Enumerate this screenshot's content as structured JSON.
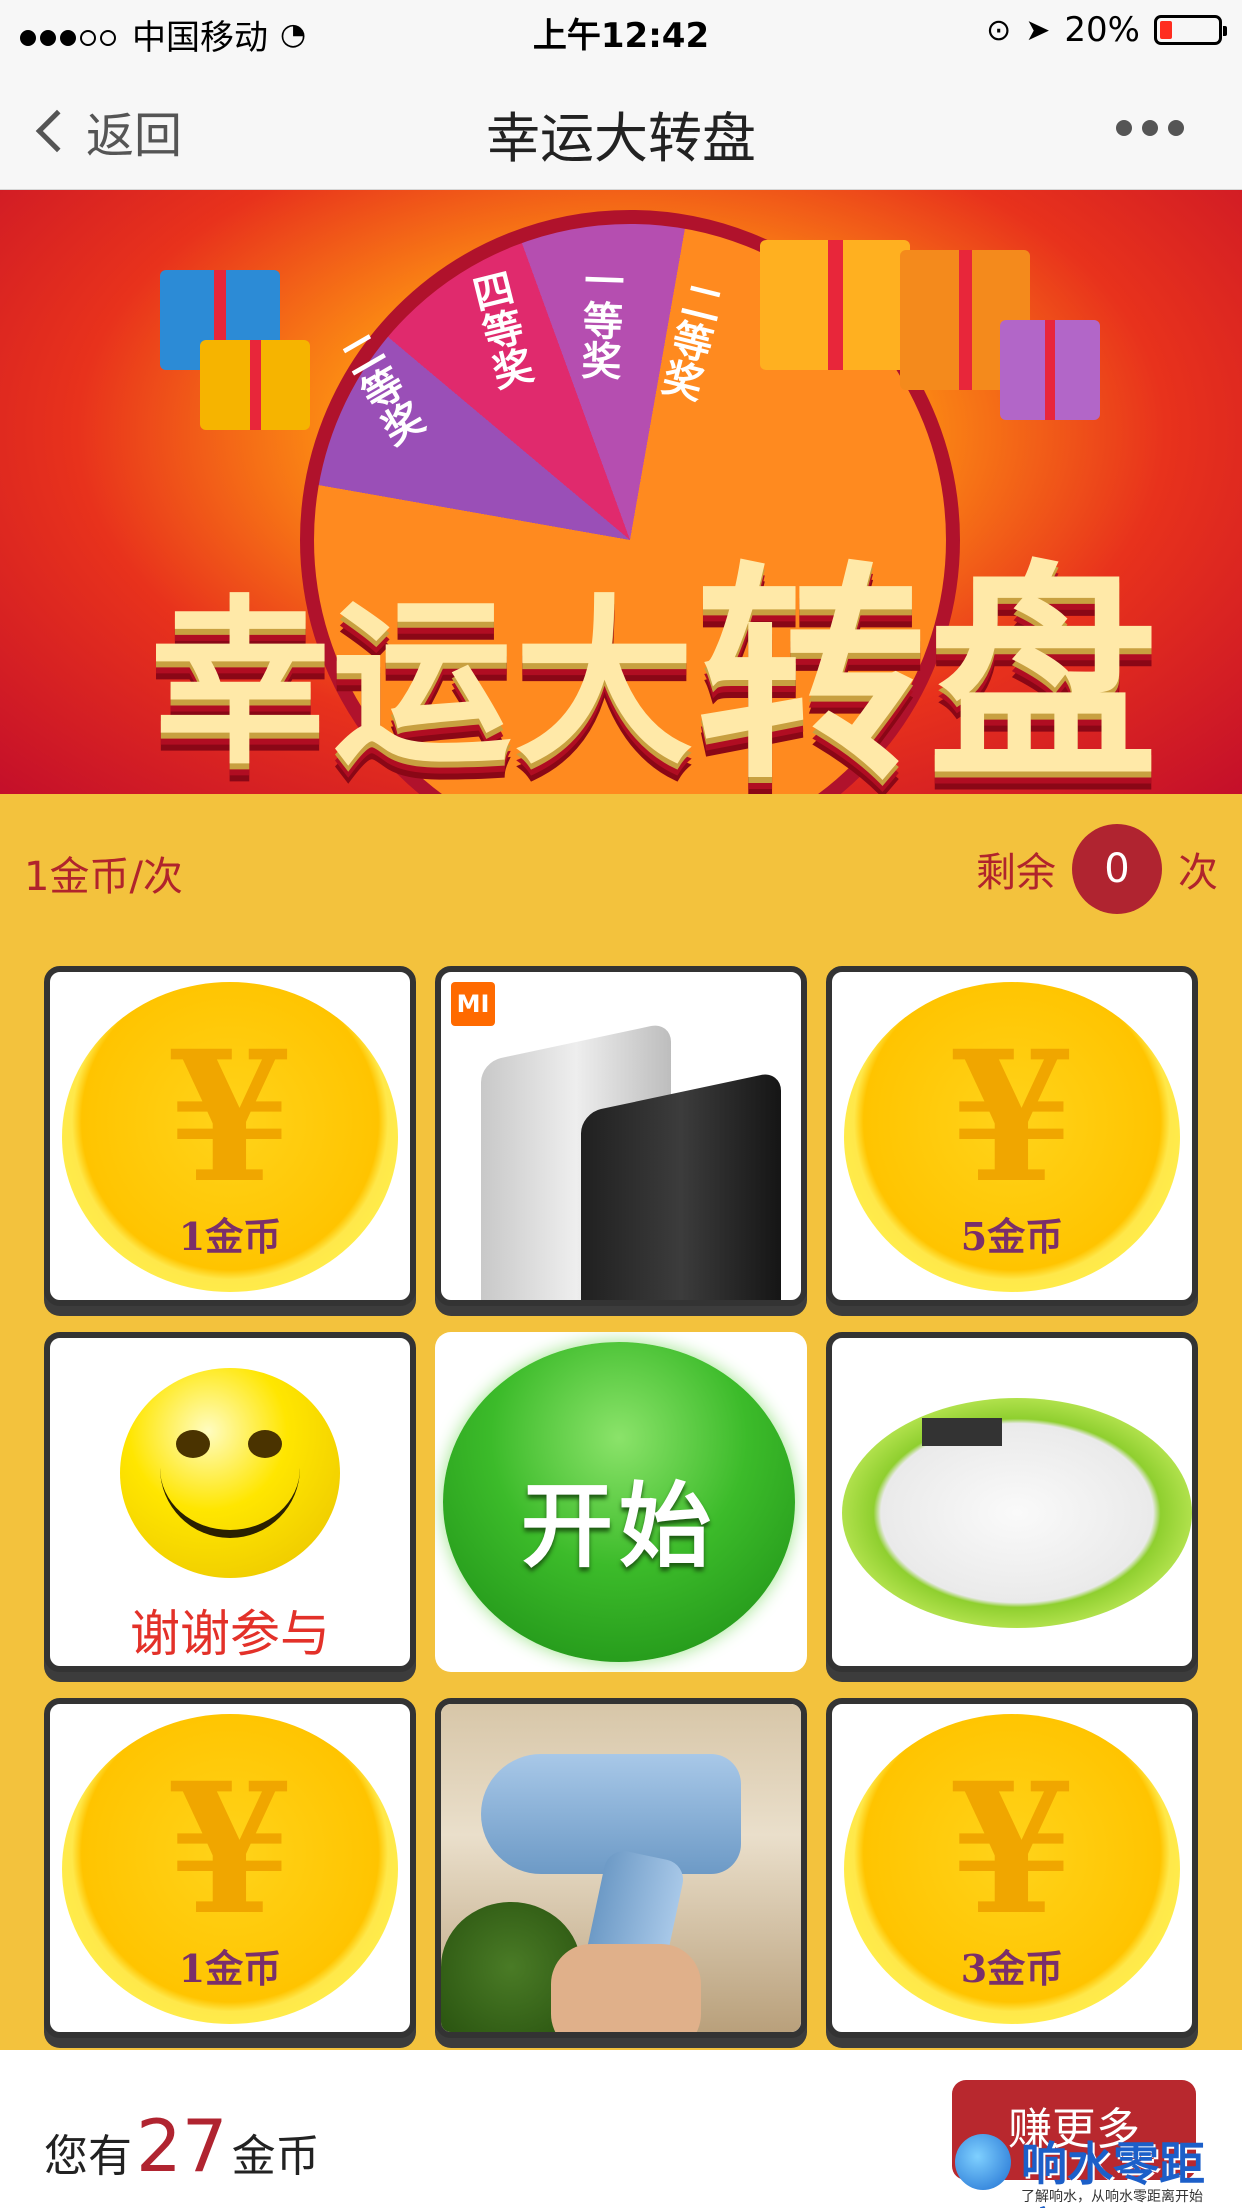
{
  "status_bar": {
    "carrier": "中国移动",
    "time": "上午12:42",
    "battery": "20%"
  },
  "nav": {
    "back_label": "返回",
    "title": "幸运大转盘"
  },
  "banner": {
    "headline_part1": "幸运大",
    "headline_part2": "转盘",
    "wheel_labels": [
      "二等奖",
      "四等奖",
      "一等奖",
      "二等奖"
    ]
  },
  "info": {
    "price": "1金币/次",
    "remain_label": "剩余",
    "remain_count": "0",
    "remain_unit": "次"
  },
  "grid": {
    "coin_1": "1金币",
    "coin_5": "5金币",
    "coin_1b": "1金币",
    "coin_3": "3金币",
    "thanks": "谢谢参与",
    "start": "开始",
    "mi_badge": "MI"
  },
  "footer": {
    "prefix": "您有",
    "coins": "27",
    "suffix": "金币",
    "earn_button": "赚更多"
  },
  "watermark": {
    "text": "响水零距离网",
    "subtitle": "了解响水，从响水零距离开始"
  },
  "colors": {
    "accent": "#b02430",
    "background": "#f3c23d"
  }
}
